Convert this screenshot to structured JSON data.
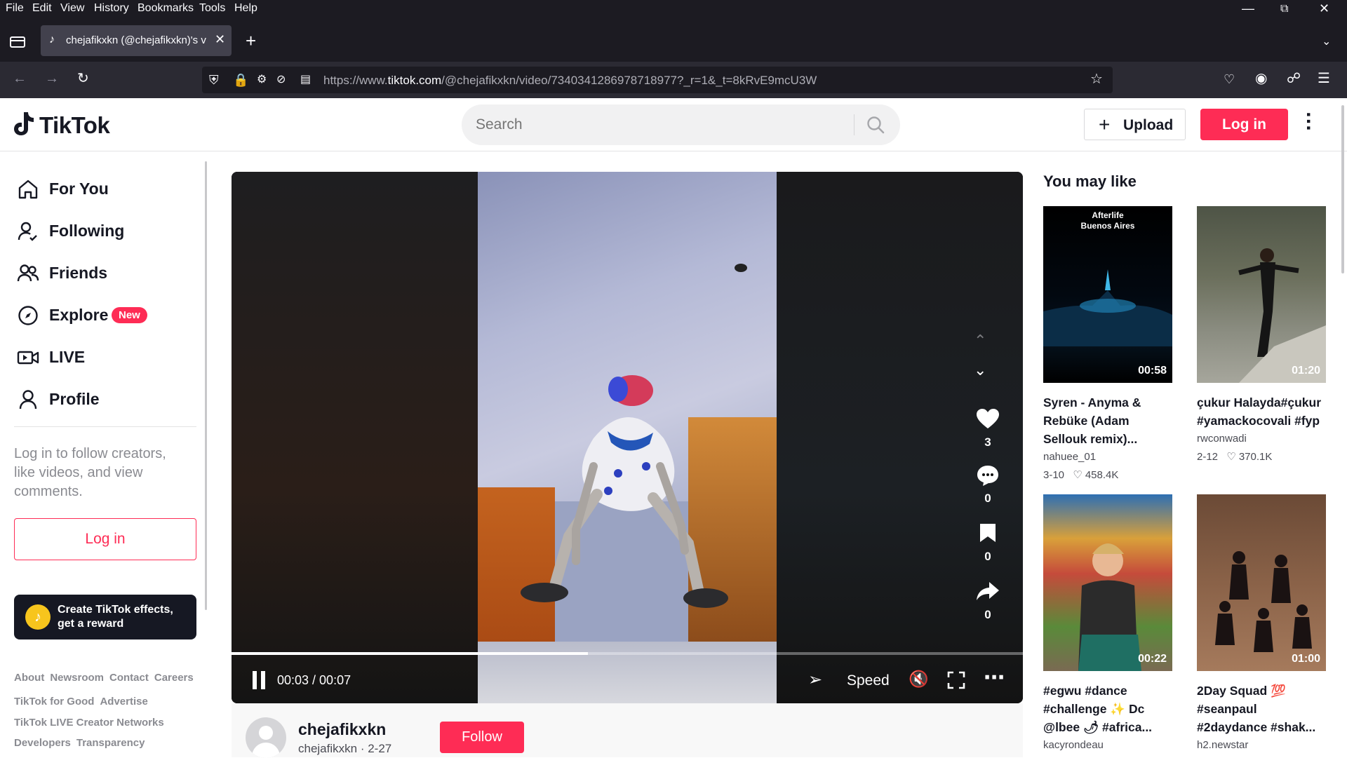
{
  "browser": {
    "menu": [
      "File",
      "Edit",
      "View",
      "History",
      "Bookmarks",
      "Tools",
      "Help"
    ],
    "tab_title": "chejafikxkn (@chejafikxkn)'s vid",
    "url_prefix": "https://www.",
    "url_domain": "tiktok.com",
    "url_rest": "/@chejafikxkn/video/7340341286978718977?_r=1&_t=8kRvE9mcU3W"
  },
  "header": {
    "logo_text": "TikTok",
    "search_placeholder": "Search",
    "upload_label": "Upload",
    "login_label": "Log in"
  },
  "sidebar": {
    "items": [
      {
        "label": "For You",
        "icon": "home-icon"
      },
      {
        "label": "Following",
        "icon": "following-icon"
      },
      {
        "label": "Friends",
        "icon": "friends-icon"
      },
      {
        "label": "Explore",
        "icon": "compass-icon",
        "badge": "New"
      },
      {
        "label": "LIVE",
        "icon": "live-icon"
      },
      {
        "label": "Profile",
        "icon": "profile-icon"
      }
    ],
    "login_prompt": "Log in to follow creators, like videos, and view comments.",
    "login_button": "Log in",
    "effects_banner": "Create TikTok effects, get a reward",
    "footer_row1": [
      "About",
      "Newsroom",
      "Contact",
      "Careers"
    ],
    "footer_row2": [
      "TikTok for Good",
      "Advertise"
    ],
    "footer_row3": [
      "TikTok LIVE Creator Networks"
    ],
    "footer_row4": [
      "Developers",
      "Transparency"
    ]
  },
  "player": {
    "time": "00:03 / 00:07",
    "progress": 0.45,
    "speed_label": "Speed",
    "likes": "3",
    "comments": "0",
    "saves": "0",
    "shares": "0"
  },
  "author": {
    "name": "chejafikxkn",
    "handle_date": "chejafikxkn · 2-27",
    "follow_label": "Follow"
  },
  "recommendations": {
    "heading": "You may like",
    "cards": [
      {
        "title": "Syren - Anyma & Rebüke (Adam Sellouk remix)...",
        "author": "nahuee_01",
        "date": "3-10",
        "likes": "458.4K",
        "duration": "00:58",
        "overlay": "Afterlife\nBuenos Aires"
      },
      {
        "title": "çukur Halayda#çukur #yamackocovali #fyp",
        "author": "rwconwadi",
        "date": "2-12",
        "likes": "370.1K",
        "duration": "01:20"
      },
      {
        "title": "#egwu #dance #challenge ✨ Dc @lbee 🌶 #africa...",
        "author": "kacyrondeau",
        "duration": "00:22"
      },
      {
        "title": "2Day Squad 💯 #seanpaul #2daydance #shak...",
        "author": "h2.newstar",
        "duration": "01:00"
      }
    ]
  },
  "colors": {
    "brand": "#fe2c55",
    "chrome_dark": "#1c1b22",
    "chrome_mid": "#2b2a33"
  }
}
